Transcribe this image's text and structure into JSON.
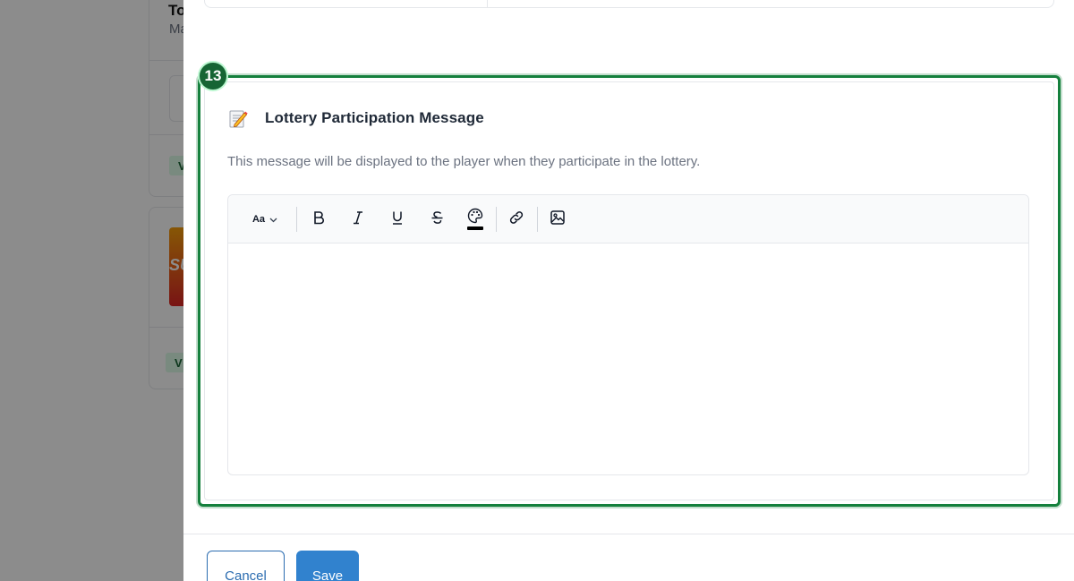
{
  "background": {
    "card_title": "To",
    "card_subtitle": "Ma",
    "badge1": "V",
    "badge2": "V",
    "thumb_text": "SU"
  },
  "section": {
    "step_number": "13",
    "title": "Lottery Participation Message",
    "description": "This message will be displayed to the player when they participate in the lottery.",
    "title_icon": "memo-icon"
  },
  "editor": {
    "toolbar": [
      {
        "name": "text-size",
        "icon": "font-size-icon",
        "label": "Aa"
      },
      {
        "name": "bold",
        "icon": "bold-icon",
        "label": "B"
      },
      {
        "name": "italic",
        "icon": "italic-icon",
        "label": "I"
      },
      {
        "name": "underline",
        "icon": "underline-icon",
        "label": "U"
      },
      {
        "name": "strikethrough",
        "icon": "strikethrough-icon",
        "label": "S"
      },
      {
        "name": "text-color",
        "icon": "palette-icon"
      },
      {
        "name": "link",
        "icon": "link-icon"
      },
      {
        "name": "image",
        "icon": "image-icon"
      }
    ],
    "content": "",
    "text_color": "#000000"
  },
  "footer": {
    "cancel_label": "Cancel",
    "save_label": "Save"
  },
  "colors": {
    "accent": "#3182ce",
    "highlight": "#15803d"
  }
}
